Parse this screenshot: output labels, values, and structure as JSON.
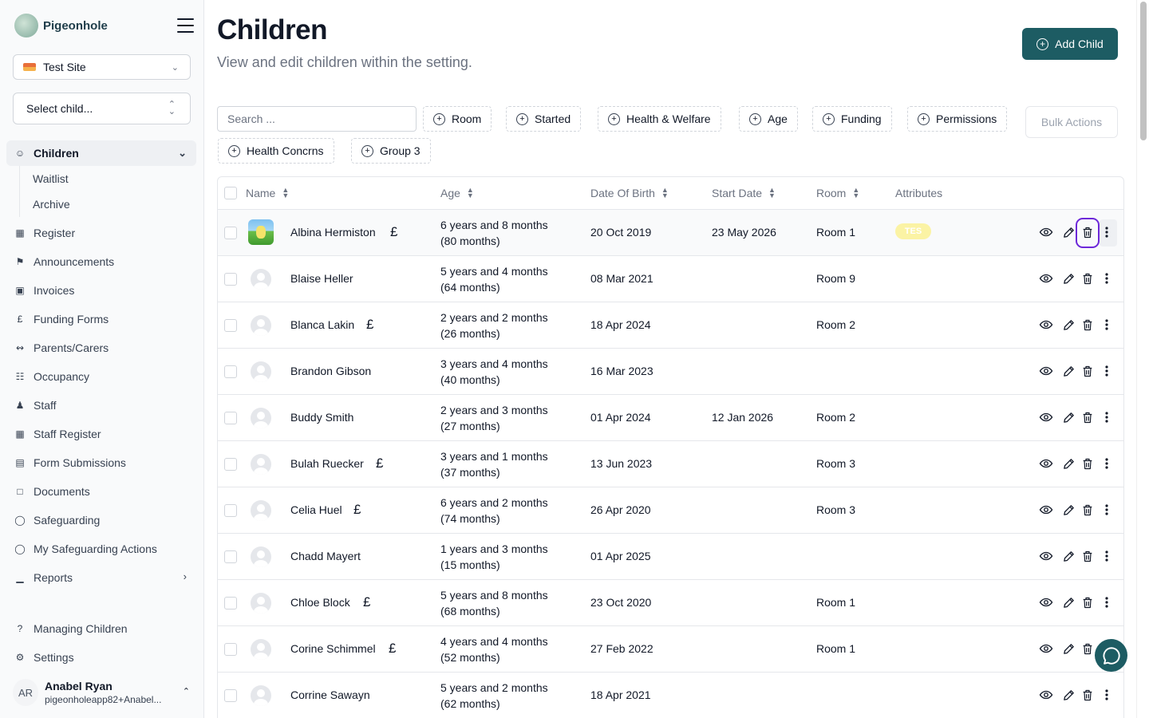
{
  "app": {
    "name": "Pigeonhole"
  },
  "sidebar": {
    "site_select": "Test Site",
    "child_select": "Select child...",
    "nav": [
      {
        "label": "Children",
        "icon": "child-face-icon"
      },
      {
        "label": "Waitlist"
      },
      {
        "label": "Archive"
      },
      {
        "label": "Register",
        "icon": "calendar-icon"
      },
      {
        "label": "Announcements",
        "icon": "megaphone-icon"
      },
      {
        "label": "Invoices",
        "icon": "wallet-icon"
      },
      {
        "label": "Funding Forms",
        "icon": "pound-icon"
      },
      {
        "label": "Parents/Carers",
        "icon": "link-icon"
      },
      {
        "label": "Occupancy",
        "icon": "grid-icon"
      },
      {
        "label": "Staff",
        "icon": "users-icon"
      },
      {
        "label": "Staff Register",
        "icon": "calendar-icon"
      },
      {
        "label": "Form Submissions",
        "icon": "document-icon"
      },
      {
        "label": "Documents",
        "icon": "folder-icon"
      },
      {
        "label": "Safeguarding",
        "icon": "shield-icon"
      },
      {
        "label": "My Safeguarding Actions",
        "icon": "shield-icon"
      },
      {
        "label": "Reports",
        "icon": "bar-chart-icon"
      }
    ],
    "footer_nav": [
      {
        "label": "Managing Children",
        "icon": "help-icon"
      },
      {
        "label": "Settings",
        "icon": "gear-icon"
      }
    ],
    "user": {
      "initials": "AR",
      "name": "Anabel Ryan",
      "email": "pigeonholeapp82+Anabel..."
    }
  },
  "header": {
    "title": "Children",
    "subtitle": "View and edit children within the setting.",
    "add_button": "Add Child"
  },
  "filters": {
    "search_placeholder": "Search ...",
    "buttons": [
      "Room",
      "Started",
      "Health & Welfare",
      "Age",
      "Funding",
      "Permissions",
      "Health Concrns",
      "Group 3"
    ],
    "bulk_actions": "Bulk Actions"
  },
  "table": {
    "columns": [
      "Name",
      "Age",
      "Date Of Birth",
      "Start Date",
      "Room",
      "Attributes"
    ],
    "rows": [
      {
        "name": "Albina Hermiston",
        "funded": "£",
        "age1": "6 years and 8 months",
        "age2": "(80 months)",
        "dob": "20 Oct 2019",
        "start": "23 May 2026",
        "room": "Room 1",
        "attribute": "TES"
      },
      {
        "name": "Blaise Heller",
        "funded": "",
        "age1": "5 years and 4 months",
        "age2": "(64 months)",
        "dob": "08 Mar 2021",
        "start": "",
        "room": "Room 9",
        "attribute": ""
      },
      {
        "name": "Blanca Lakin",
        "funded": "£",
        "age1": "2 years and 2 months",
        "age2": "(26 months)",
        "dob": "18 Apr 2024",
        "start": "",
        "room": "Room 2",
        "attribute": ""
      },
      {
        "name": "Brandon Gibson",
        "funded": "",
        "age1": "3 years and 4 months",
        "age2": "(40 months)",
        "dob": "16 Mar 2023",
        "start": "",
        "room": "",
        "attribute": ""
      },
      {
        "name": "Buddy Smith",
        "funded": "",
        "age1": "2 years and 3 months",
        "age2": "(27 months)",
        "dob": "01 Apr 2024",
        "start": "12 Jan 2026",
        "room": "Room 2",
        "attribute": ""
      },
      {
        "name": "Bulah Ruecker",
        "funded": "£",
        "age1": "3 years and 1 months",
        "age2": "(37 months)",
        "dob": "13 Jun 2023",
        "start": "",
        "room": "Room 3",
        "attribute": ""
      },
      {
        "name": "Celia Huel",
        "funded": "£",
        "age1": "6 years and 2 months",
        "age2": "(74 months)",
        "dob": "26 Apr 2020",
        "start": "",
        "room": "Room 3",
        "attribute": ""
      },
      {
        "name": "Chadd Mayert",
        "funded": "",
        "age1": "1 years and 3 months",
        "age2": "(15 months)",
        "dob": "01 Apr 2025",
        "start": "",
        "room": "",
        "attribute": ""
      },
      {
        "name": "Chloe Block",
        "funded": "£",
        "age1": "5 years and 8 months",
        "age2": "(68 months)",
        "dob": "23 Oct 2020",
        "start": "",
        "room": "Room 1",
        "attribute": ""
      },
      {
        "name": "Corine Schimmel",
        "funded": "£",
        "age1": "4 years and 4 months",
        "age2": "(52 months)",
        "dob": "27 Feb 2022",
        "start": "",
        "room": "Room 1",
        "attribute": ""
      },
      {
        "name": "Corrine Sawayn",
        "funded": "",
        "age1": "5 years and 2 months",
        "age2": "(62 months)",
        "dob": "18 Apr 2021",
        "start": "",
        "room": "",
        "attribute": ""
      }
    ]
  },
  "colors": {
    "accent": "#1d5c63",
    "focus_ring": "#6d28d9",
    "badge": "#fbf3a4"
  }
}
